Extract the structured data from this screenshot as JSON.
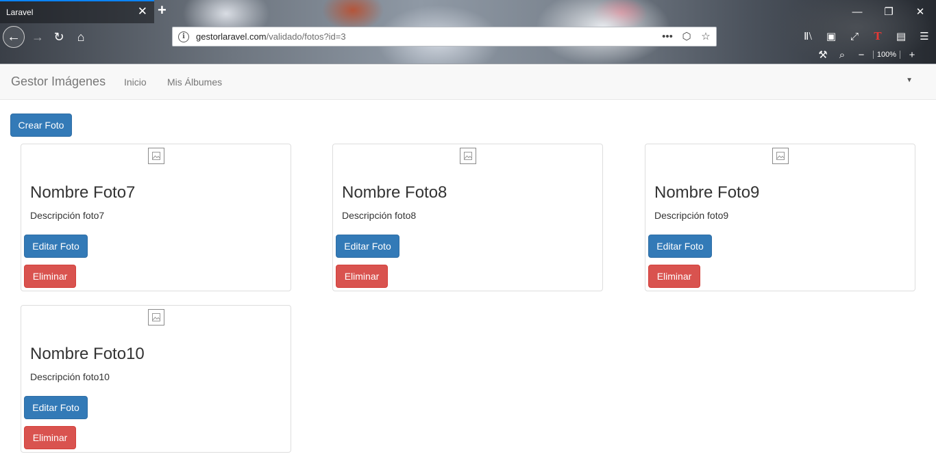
{
  "browser": {
    "tab_title": "Laravel",
    "tab_close": "✕",
    "new_tab": "+",
    "url_domain": "gestorlaravel.com",
    "url_path": "/validado/fotos?id=3",
    "zoom_level": "100%"
  },
  "navbar": {
    "brand": "Gestor Imágenes",
    "links": [
      "Inicio",
      "Mis Álbumes"
    ],
    "dropdown_caret": "▼"
  },
  "page": {
    "create_button": "Crear Foto"
  },
  "photos": [
    {
      "title": "Nombre Foto7",
      "description": "Descripción foto7",
      "edit_label": "Editar Foto",
      "delete_label": "Eliminar"
    },
    {
      "title": "Nombre Foto8",
      "description": "Descripción foto8",
      "edit_label": "Editar Foto",
      "delete_label": "Eliminar"
    },
    {
      "title": "Nombre Foto9",
      "description": "Descripción foto9",
      "edit_label": "Editar Foto",
      "delete_label": "Eliminar"
    },
    {
      "title": "Nombre Foto10",
      "description": "Descripción foto10",
      "edit_label": "Editar Foto",
      "delete_label": "Eliminar"
    }
  ],
  "colors": {
    "primary": "#337ab7",
    "danger": "#d9534f",
    "navbar_bg": "#f8f8f8"
  }
}
